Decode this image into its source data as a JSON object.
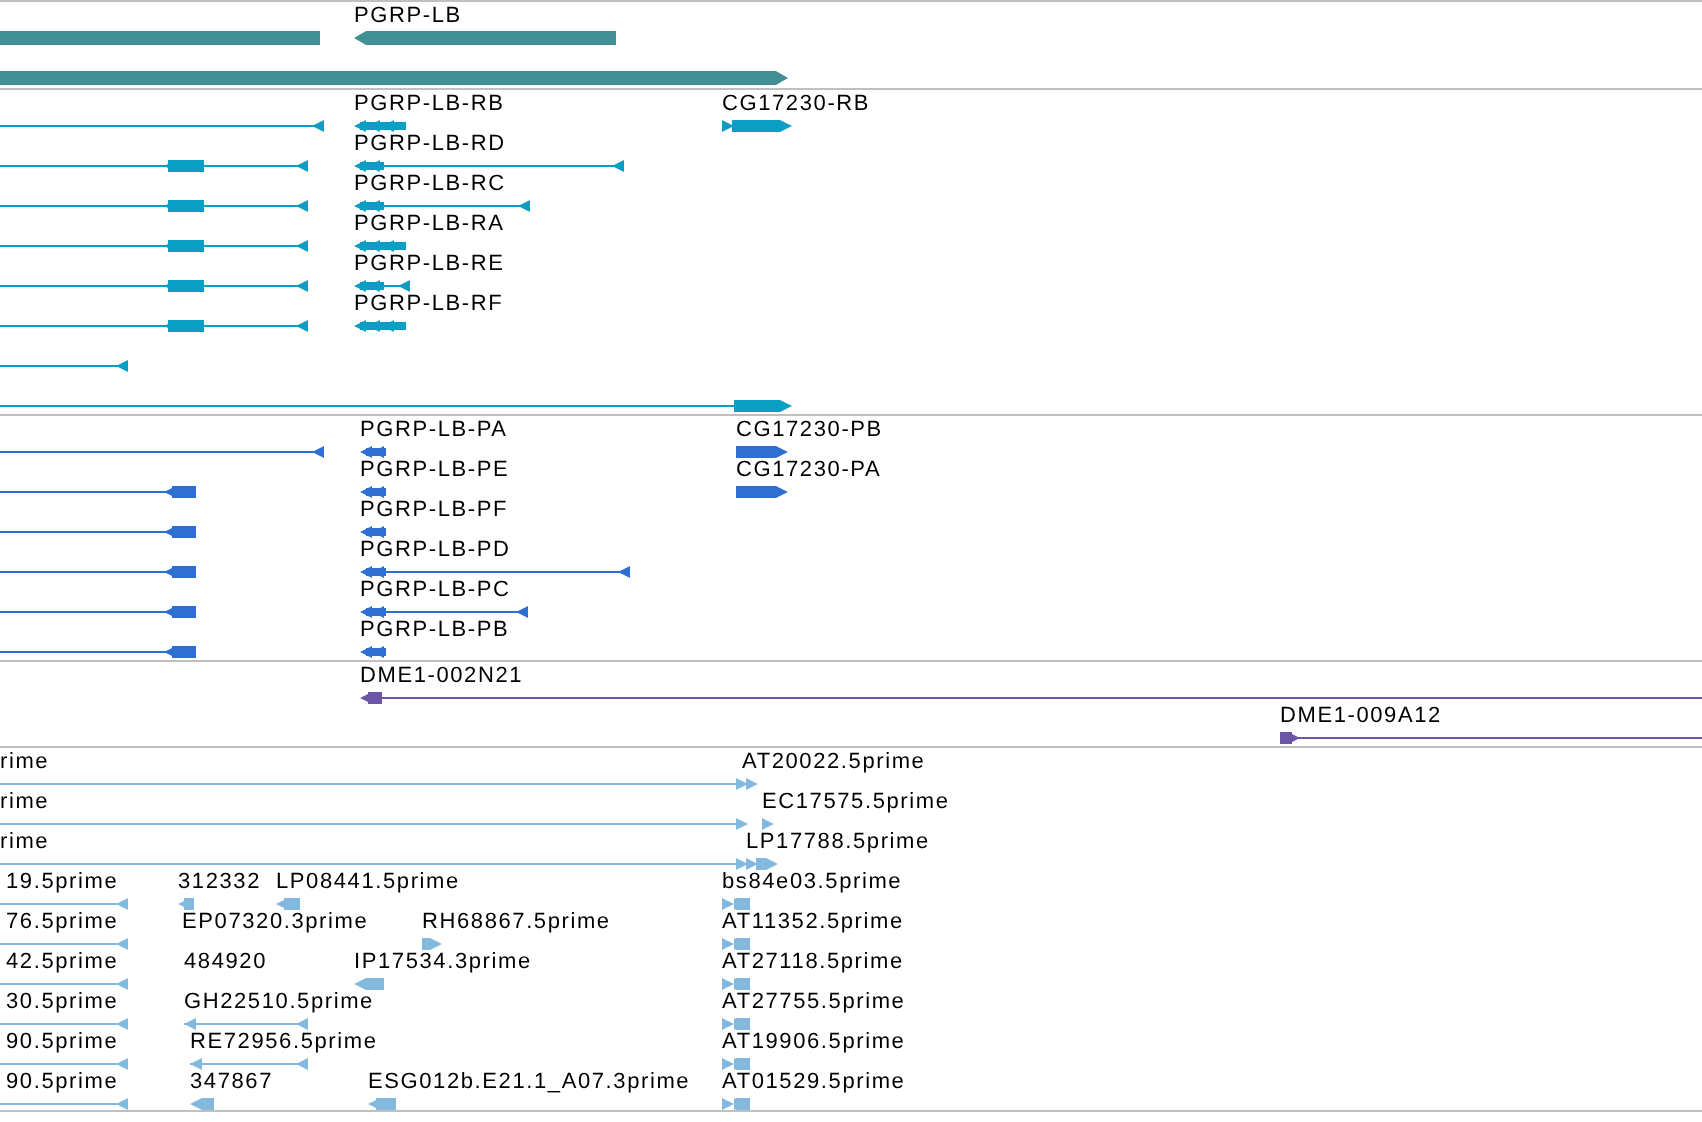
{
  "tracks": [
    {
      "color": "#418f93",
      "features": [
        {
          "label": "PGRP-LB"
        }
      ]
    },
    {
      "color": "#0a9ec4",
      "features": [
        {
          "label": "PGRP-LB-RB"
        },
        {
          "label": "CG17230-RB"
        },
        {
          "label": "PGRP-LB-RD"
        },
        {
          "label": "PGRP-LB-RC"
        },
        {
          "label": "PGRP-LB-RA"
        },
        {
          "label": "PGRP-LB-RE"
        },
        {
          "label": "PGRP-LB-RF"
        }
      ]
    },
    {
      "color": "#2f6fd1",
      "features": [
        {
          "label": "PGRP-LB-PA"
        },
        {
          "label": "CG17230-PB"
        },
        {
          "label": "PGRP-LB-PE"
        },
        {
          "label": "CG17230-PA"
        },
        {
          "label": "PGRP-LB-PF"
        },
        {
          "label": "PGRP-LB-PD"
        },
        {
          "label": "PGRP-LB-PC"
        },
        {
          "label": "PGRP-LB-PB"
        }
      ]
    },
    {
      "color": "#6b55a5",
      "features": [
        {
          "label": "DME1-002N21"
        },
        {
          "label": "DME1-009A12"
        }
      ]
    },
    {
      "color": "#83b9de",
      "features": [
        {
          "label": "rime"
        },
        {
          "label": "AT20022.5prime"
        },
        {
          "label": "rime"
        },
        {
          "label": "EC17575.5prime"
        },
        {
          "label": "rime"
        },
        {
          "label": "LP17788.5prime"
        },
        {
          "label": "19.5prime"
        },
        {
          "label": "312332"
        },
        {
          "label": "LP08441.5prime"
        },
        {
          "label": "bs84e03.5prime"
        },
        {
          "label": "76.5prime"
        },
        {
          "label": "EP07320.3prime"
        },
        {
          "label": "RH68867.5prime"
        },
        {
          "label": "AT11352.5prime"
        },
        {
          "label": "42.5prime"
        },
        {
          "label": "484920"
        },
        {
          "label": "IP17534.3prime"
        },
        {
          "label": "AT27118.5prime"
        },
        {
          "label": "30.5prime"
        },
        {
          "label": "GH22510.5prime"
        },
        {
          "label": "AT27755.5prime"
        },
        {
          "label": "90.5prime"
        },
        {
          "label": "RE72956.5prime"
        },
        {
          "label": "AT19906.5prime"
        },
        {
          "label": "90.5prime"
        },
        {
          "label": "347867"
        },
        {
          "label": "ESG012b.E21.1_A07.3prime"
        },
        {
          "label": "AT01529.5prime"
        }
      ]
    }
  ]
}
